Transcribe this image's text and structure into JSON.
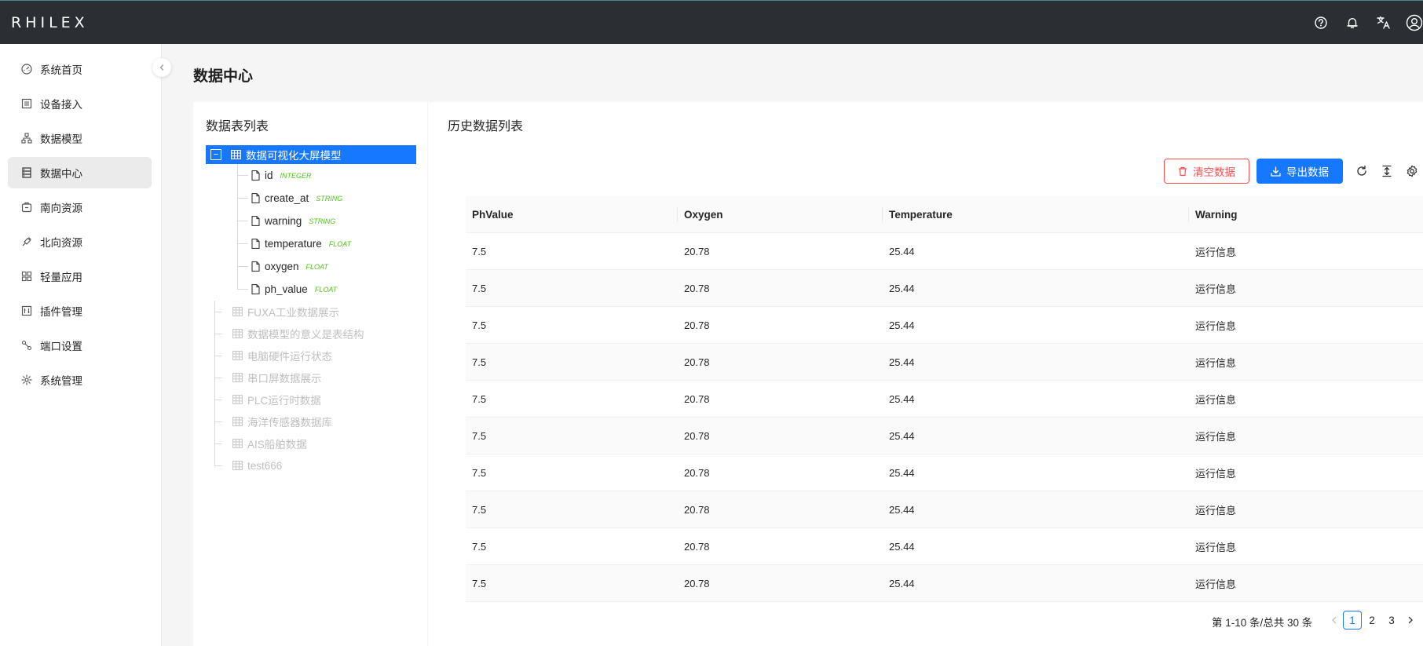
{
  "app": {
    "logo": "RHILEX"
  },
  "header": {
    "icons": [
      "help-icon",
      "bell-icon",
      "translate-icon",
      "user-icon"
    ]
  },
  "sidebar": {
    "items": [
      {
        "label": "系统首页",
        "icon": "dashboard-icon",
        "active": false
      },
      {
        "label": "设备接入",
        "icon": "device-icon",
        "active": false
      },
      {
        "label": "数据模型",
        "icon": "model-icon",
        "active": false
      },
      {
        "label": "数据中心",
        "icon": "database-icon",
        "active": true
      },
      {
        "label": "南向资源",
        "icon": "southbound-icon",
        "active": false
      },
      {
        "label": "北向资源",
        "icon": "northbound-icon",
        "active": false
      },
      {
        "label": "轻量应用",
        "icon": "apps-icon",
        "active": false
      },
      {
        "label": "插件管理",
        "icon": "plugin-icon",
        "active": false
      },
      {
        "label": "端口设置",
        "icon": "port-icon",
        "active": false
      },
      {
        "label": "系统管理",
        "icon": "settings-icon",
        "active": false
      }
    ]
  },
  "page": {
    "title": "数据中心"
  },
  "left_panel": {
    "title": "数据表列表",
    "tree": {
      "root": "数据可视化大屏模型",
      "fields": [
        {
          "name": "id",
          "type": "INTEGER"
        },
        {
          "name": "create_at",
          "type": "STRING"
        },
        {
          "name": "warning",
          "type": "STRING"
        },
        {
          "name": "temperature",
          "type": "FLOAT"
        },
        {
          "name": "oxygen",
          "type": "FLOAT"
        },
        {
          "name": "ph_value",
          "type": "FLOAT"
        }
      ],
      "siblings": [
        "FUXA工业数据展示",
        "数据模型的意义是表结构",
        "电脑硬件运行状态",
        "串口屏数据展示",
        "PLC运行时数据",
        "海洋传感器数据库",
        "AIS船舶数据",
        "test666"
      ]
    }
  },
  "right_panel": {
    "title": "历史数据列表",
    "toolbar": {
      "clear_label": "清空数据",
      "export_label": "导出数据"
    },
    "table": {
      "columns": [
        "PhValue",
        "Oxygen",
        "Temperature",
        "Warning"
      ],
      "rows": [
        [
          "7.5",
          "20.78",
          "25.44",
          "运行信息"
        ],
        [
          "7.5",
          "20.78",
          "25.44",
          "运行信息"
        ],
        [
          "7.5",
          "20.78",
          "25.44",
          "运行信息"
        ],
        [
          "7.5",
          "20.78",
          "25.44",
          "运行信息"
        ],
        [
          "7.5",
          "20.78",
          "25.44",
          "运行信息"
        ],
        [
          "7.5",
          "20.78",
          "25.44",
          "运行信息"
        ],
        [
          "7.5",
          "20.78",
          "25.44",
          "运行信息"
        ],
        [
          "7.5",
          "20.78",
          "25.44",
          "运行信息"
        ],
        [
          "7.5",
          "20.78",
          "25.44",
          "运行信息"
        ],
        [
          "7.5",
          "20.78",
          "25.44",
          "运行信息"
        ]
      ]
    },
    "pagination": {
      "total_text": "第 1-10 条/总共 30 条",
      "pages": [
        "1",
        "2",
        "3"
      ],
      "current": "1"
    }
  }
}
